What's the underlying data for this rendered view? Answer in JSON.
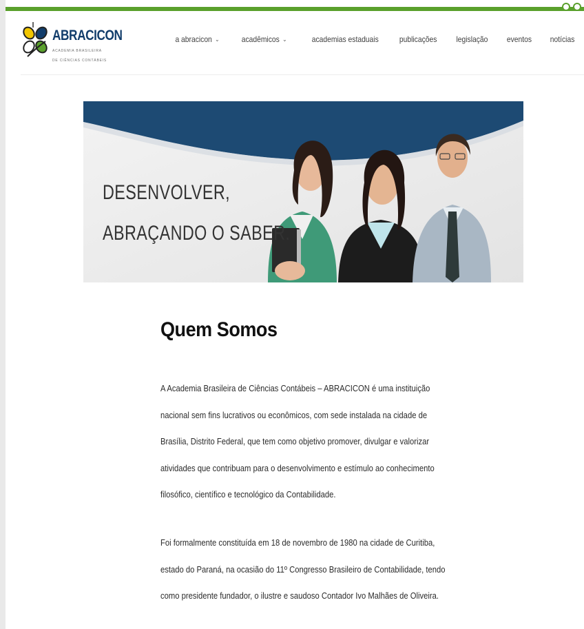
{
  "logo": {
    "name": "ABRACICON",
    "subtitle_line1": "ACADEMIA BRASILEIRA",
    "subtitle_line2": "DE CIÊNCIAS CONTÁBEIS"
  },
  "nav": {
    "items": [
      {
        "label": "a abracicon",
        "dropdown": true
      },
      {
        "label": "acadêmicos",
        "dropdown": true
      },
      {
        "label": "academias estaduais",
        "dropdown": false
      },
      {
        "label": "publicações",
        "dropdown": false
      },
      {
        "label": "legislação",
        "dropdown": false
      },
      {
        "label": "eventos",
        "dropdown": false
      },
      {
        "label": "notícias",
        "dropdown": false
      }
    ],
    "chevron": "⌄"
  },
  "banner": {
    "line1": "DESENVOLVER,",
    "line2": "ABRAÇANDO O SABER."
  },
  "main": {
    "heading": "Quem Somos",
    "paragraph1": "A Academia Brasileira de Ciências Contábeis – ABRACICON é uma instituição nacional sem fins lucrativos ou econômicos, com sede instalada na cidade de Brasília, Distrito Federal, que tem como objetivo promover, divulgar e valorizar atividades que contribuam para o desenvolvimento e estímulo ao conhecimento filosófico, científico e tecnológico da Contabilidade.",
    "paragraph2": "Foi formalmente constituída em 18 de novembro de 1980 na cidade de Curitiba, estado do Paraná, na ocasião do 11º Congresso Brasileiro de Contabilidade, tendo como presidente fundador, o ilustre e saudoso Contador Ivo Malhães de Oliveira."
  },
  "colors": {
    "brand_green": "#5aa02c",
    "brand_blue": "#123d6b",
    "banner_blue": "#1d4a73"
  },
  "icons": [
    "social-icon",
    "social-icon"
  ]
}
